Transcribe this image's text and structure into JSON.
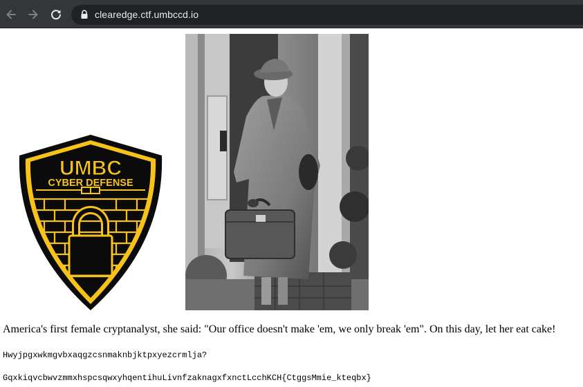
{
  "browser": {
    "url": "clearedge.ctf.umbccd.io",
    "icons": {
      "back": "arrow-left-icon",
      "forward": "arrow-right-icon",
      "reload": "reload-icon",
      "secure": "lock-icon"
    }
  },
  "logo": {
    "line1": "UMBC",
    "line2": "CYBER DEFENSE",
    "colors": {
      "gold": "#f7c31a",
      "black": "#0b0b0b"
    }
  },
  "photo": {
    "description_icon": "photo-woman-with-briefcase"
  },
  "content": {
    "caption": "America's first female cryptanalyst, she said: \"Our office doesn't make 'em, we only break 'em\". On this day, let her eat cake!",
    "cipher_line_1": "Hwyjpgxwkmgvbxaqgzcsnmaknbjktpxyezcrmlja?",
    "cipher_line_2": "GqxkiqvcbwvzmmxhspcsqwxyhqentihuLivnfzaknagxfxnctLcchKCH{CtggsMmie_kteqbx}"
  }
}
